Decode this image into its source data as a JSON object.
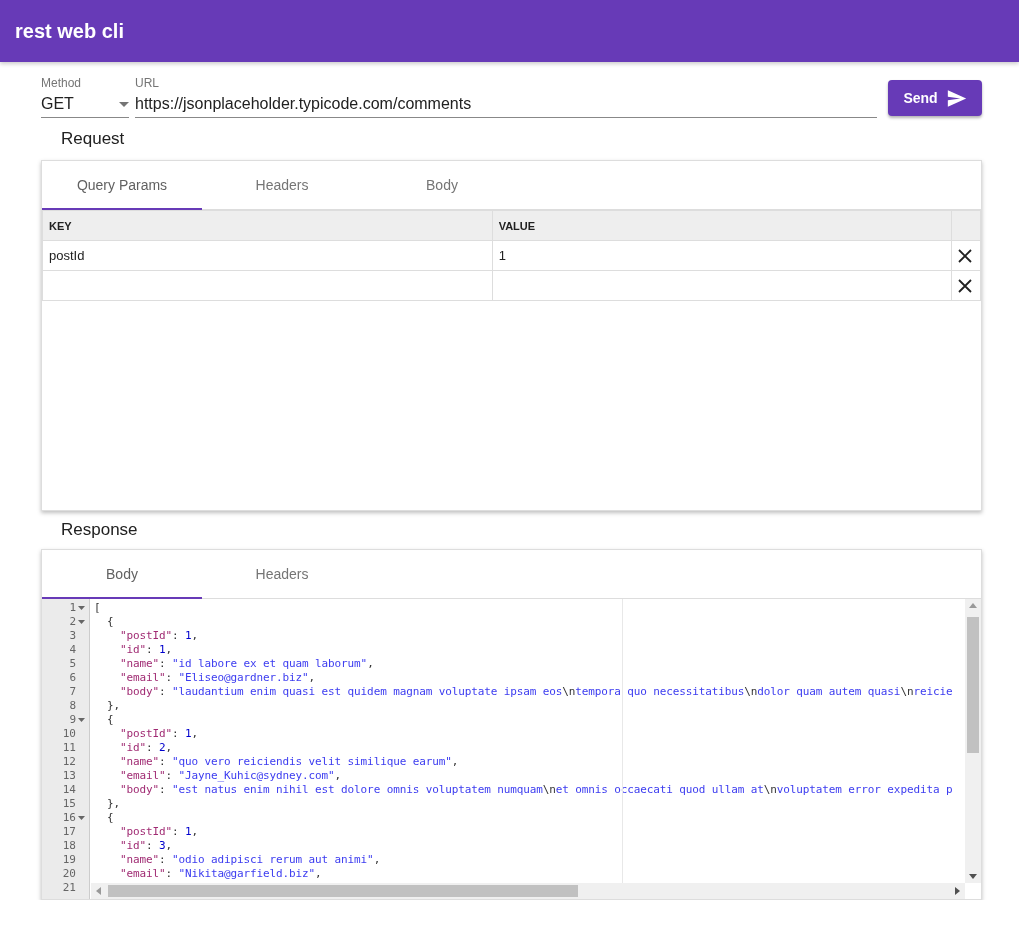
{
  "app_bar": {
    "title": "rest web cli"
  },
  "request_line": {
    "method_label": "Method",
    "method": "GET",
    "url_label": "URL",
    "url": "https://jsonplaceholder.typicode.com/comments",
    "send_button": "Send"
  },
  "request": {
    "heading": "Request",
    "tabs": [
      {
        "label": "Query Params",
        "selected": true
      },
      {
        "label": "Headers",
        "selected": false
      },
      {
        "label": "Body",
        "selected": false
      }
    ],
    "params_table": {
      "columns": [
        "KEY",
        "VALUE"
      ],
      "rows": [
        {
          "key": "postId",
          "value": "1"
        },
        {}
      ]
    }
  },
  "response": {
    "heading": "Response",
    "tabs": [
      {
        "label": "Body",
        "selected": true
      },
      {
        "label": "Headers",
        "selected": false
      }
    ],
    "editor": {
      "lines": [
        {
          "n": "1",
          "fold": true,
          "tokens": [
            {
              "kind": "punct",
              "text": "["
            }
          ]
        },
        {
          "n": "2",
          "fold": true,
          "tokens": [
            {
              "kind": "punct",
              "text": "  {"
            }
          ]
        },
        {
          "n": "3",
          "fold": false,
          "tokens": [
            {
              "kind": "key",
              "text": "    \"postId\""
            },
            {
              "kind": "punct",
              "text": ": "
            },
            {
              "kind": "number",
              "text": "1"
            },
            {
              "kind": "punct",
              "text": ","
            }
          ]
        },
        {
          "n": "4",
          "fold": false,
          "tokens": [
            {
              "kind": "key",
              "text": "    \"id\""
            },
            {
              "kind": "punct",
              "text": ": "
            },
            {
              "kind": "number",
              "text": "1"
            },
            {
              "kind": "punct",
              "text": ","
            }
          ]
        },
        {
          "n": "5",
          "fold": false,
          "tokens": [
            {
              "kind": "key",
              "text": "    \"name\""
            },
            {
              "kind": "punct",
              "text": ": "
            },
            {
              "kind": "string",
              "text": "\"id labore ex et quam laborum\""
            },
            {
              "kind": "punct",
              "text": ","
            }
          ]
        },
        {
          "n": "6",
          "fold": false,
          "tokens": [
            {
              "kind": "key",
              "text": "    \"email\""
            },
            {
              "kind": "punct",
              "text": ": "
            },
            {
              "kind": "string",
              "text": "\"Eliseo@gardner.biz\""
            },
            {
              "kind": "punct",
              "text": ","
            }
          ]
        },
        {
          "n": "7",
          "fold": false,
          "tokens": [
            {
              "kind": "key",
              "text": "    \"body\""
            },
            {
              "kind": "punct",
              "text": ": "
            },
            {
              "kind": "string",
              "text": "\"laudantium enim quasi est quidem magnam voluptate ipsam eos"
            },
            {
              "kind": "escape",
              "text": "\\n"
            },
            {
              "kind": "string",
              "text": "tempora quo necessitatibus"
            },
            {
              "kind": "escape",
              "text": "\\n"
            },
            {
              "kind": "string",
              "text": "dolor quam autem quasi"
            },
            {
              "kind": "escape",
              "text": "\\n"
            },
            {
              "kind": "string",
              "text": "reicie"
            }
          ]
        },
        {
          "n": "8",
          "fold": false,
          "tokens": [
            {
              "kind": "punct",
              "text": "  },"
            }
          ]
        },
        {
          "n": "9",
          "fold": true,
          "tokens": [
            {
              "kind": "punct",
              "text": "  {"
            }
          ]
        },
        {
          "n": "10",
          "fold": false,
          "tokens": [
            {
              "kind": "key",
              "text": "    \"postId\""
            },
            {
              "kind": "punct",
              "text": ": "
            },
            {
              "kind": "number",
              "text": "1"
            },
            {
              "kind": "punct",
              "text": ","
            }
          ]
        },
        {
          "n": "11",
          "fold": false,
          "tokens": [
            {
              "kind": "key",
              "text": "    \"id\""
            },
            {
              "kind": "punct",
              "text": ": "
            },
            {
              "kind": "number",
              "text": "2"
            },
            {
              "kind": "punct",
              "text": ","
            }
          ]
        },
        {
          "n": "12",
          "fold": false,
          "tokens": [
            {
              "kind": "key",
              "text": "    \"name\""
            },
            {
              "kind": "punct",
              "text": ": "
            },
            {
              "kind": "string",
              "text": "\"quo vero reiciendis velit similique earum\""
            },
            {
              "kind": "punct",
              "text": ","
            }
          ]
        },
        {
          "n": "13",
          "fold": false,
          "tokens": [
            {
              "kind": "key",
              "text": "    \"email\""
            },
            {
              "kind": "punct",
              "text": ": "
            },
            {
              "kind": "string",
              "text": "\"Jayne_Kuhic@sydney.com\""
            },
            {
              "kind": "punct",
              "text": ","
            }
          ]
        },
        {
          "n": "14",
          "fold": false,
          "tokens": [
            {
              "kind": "key",
              "text": "    \"body\""
            },
            {
              "kind": "punct",
              "text": ": "
            },
            {
              "kind": "string",
              "text": "\"est natus enim nihil est dolore omnis voluptatem numquam"
            },
            {
              "kind": "escape",
              "text": "\\n"
            },
            {
              "kind": "string",
              "text": "et omnis occaecati quod ullam at"
            },
            {
              "kind": "escape",
              "text": "\\n"
            },
            {
              "kind": "string",
              "text": "voluptatem error expedita p"
            }
          ]
        },
        {
          "n": "15",
          "fold": false,
          "tokens": [
            {
              "kind": "punct",
              "text": "  },"
            }
          ]
        },
        {
          "n": "16",
          "fold": true,
          "tokens": [
            {
              "kind": "punct",
              "text": "  {"
            }
          ]
        },
        {
          "n": "17",
          "fold": false,
          "tokens": [
            {
              "kind": "key",
              "text": "    \"postId\""
            },
            {
              "kind": "punct",
              "text": ": "
            },
            {
              "kind": "number",
              "text": "1"
            },
            {
              "kind": "punct",
              "text": ","
            }
          ]
        },
        {
          "n": "18",
          "fold": false,
          "tokens": [
            {
              "kind": "key",
              "text": "    \"id\""
            },
            {
              "kind": "punct",
              "text": ": "
            },
            {
              "kind": "number",
              "text": "3"
            },
            {
              "kind": "punct",
              "text": ","
            }
          ]
        },
        {
          "n": "19",
          "fold": false,
          "tokens": [
            {
              "kind": "key",
              "text": "    \"name\""
            },
            {
              "kind": "punct",
              "text": ": "
            },
            {
              "kind": "string",
              "text": "\"odio adipisci rerum aut animi\""
            },
            {
              "kind": "punct",
              "text": ","
            }
          ]
        },
        {
          "n": "20",
          "fold": false,
          "tokens": [
            {
              "kind": "key",
              "text": "    \"email\""
            },
            {
              "kind": "punct",
              "text": ": "
            },
            {
              "kind": "string",
              "text": "\"Nikita@garfield.biz\""
            },
            {
              "kind": "punct",
              "text": ","
            }
          ]
        },
        {
          "n": "21",
          "fold": false
        }
      ]
    }
  }
}
